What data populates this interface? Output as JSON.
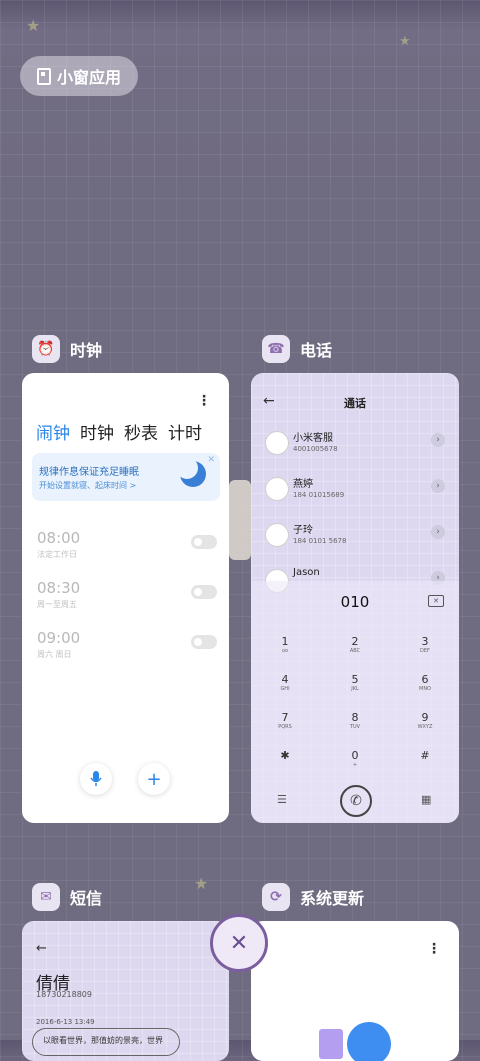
{
  "small_window": {
    "label": "小窗应用"
  },
  "apps": {
    "clock": {
      "name": "时钟",
      "tabs": [
        "闹钟",
        "计时",
        "秒表",
        "计时"
      ],
      "tab_labels": {
        "alarm": "闹钟",
        "clock": "时钟",
        "stopwatch": "秒表",
        "timer": "计时"
      },
      "banner_title": "规律作息保证充足睡眠",
      "banner_sub": "开始设置就寝、起床时间 >",
      "alarms": [
        {
          "time": "08:00",
          "label": "法定工作日"
        },
        {
          "time": "08:30",
          "label": "周一至周五"
        },
        {
          "time": "09:00",
          "label": "周六 周日"
        }
      ]
    },
    "phone": {
      "name": "电话",
      "title": "通话",
      "contacts": [
        {
          "name": "小米客服",
          "number": "4001005678"
        },
        {
          "name": "燕婷",
          "number": "184 01015689"
        },
        {
          "name": "子玲",
          "number": "184 0101 5678"
        },
        {
          "name": "Jason",
          "number": ""
        }
      ],
      "dial_input": "010",
      "keys": [
        {
          "d": "1",
          "l": "oo"
        },
        {
          "d": "2",
          "l": "ABC"
        },
        {
          "d": "3",
          "l": "DEF"
        },
        {
          "d": "4",
          "l": "GHI"
        },
        {
          "d": "5",
          "l": "JKL"
        },
        {
          "d": "6",
          "l": "MNO"
        },
        {
          "d": "7",
          "l": "PQRS"
        },
        {
          "d": "8",
          "l": "TUV"
        },
        {
          "d": "9",
          "l": "WXYZ"
        },
        {
          "d": "✱",
          "l": ""
        },
        {
          "d": "0",
          "l": "+"
        },
        {
          "d": "#",
          "l": ""
        }
      ]
    },
    "sms": {
      "name": "短信",
      "contact": "倩倩",
      "number": "18730218809",
      "date": "2016-6-13 13:49",
      "message": "以眼看世界，那值妨的景亮，世界"
    },
    "update": {
      "name": "系统更新"
    }
  },
  "close_all": {
    "symbol": "✕"
  }
}
